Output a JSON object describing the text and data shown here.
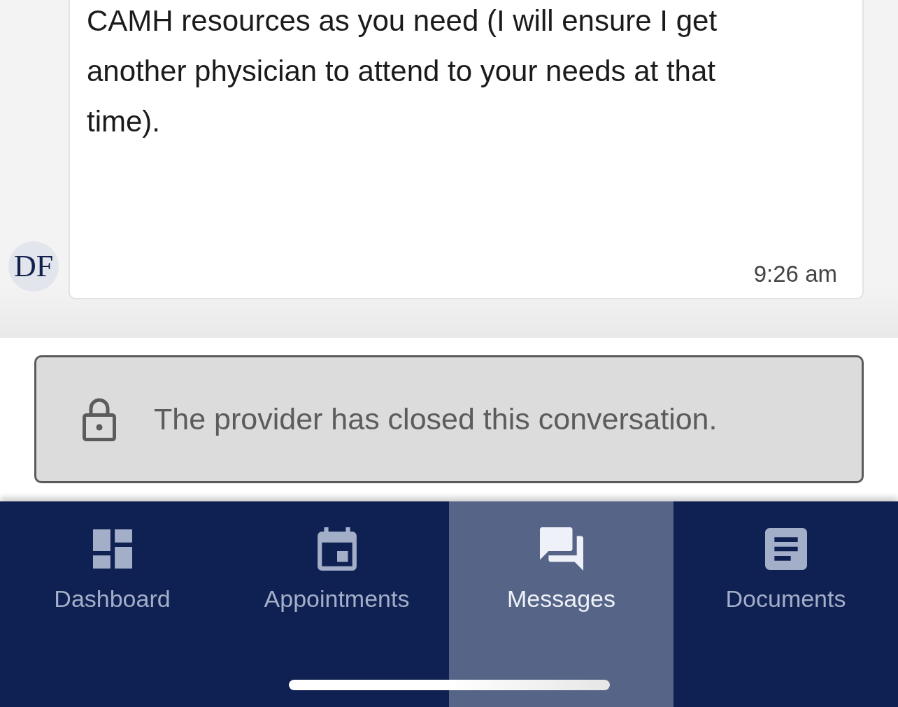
{
  "conversation": {
    "messages": [
      {
        "sender_initials": "DF",
        "text": "CAMH resources as you need (I will ensure I get another physician to attend to your needs at that time).",
        "time": "9:26 am"
      }
    ],
    "closed_notice": "The provider has closed this conversation."
  },
  "tab_bar": {
    "tabs": [
      {
        "label": "Dashboard",
        "selected": false
      },
      {
        "label": "Appointments",
        "selected": false
      },
      {
        "label": "Messages",
        "selected": true
      },
      {
        "label": "Documents",
        "selected": false
      }
    ]
  }
}
